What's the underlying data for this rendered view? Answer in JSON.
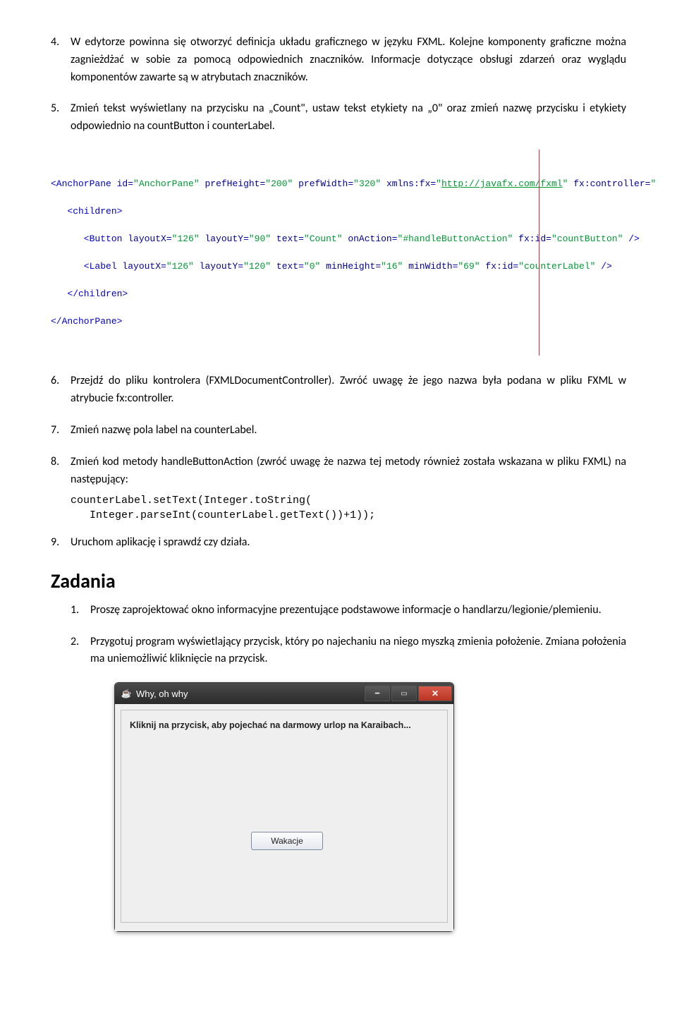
{
  "paragraphs": {
    "p4": "W edytorze powinna się otworzyć definicja układu graficznego w języku FXML. Kolejne komponenty graficzne można zagnieżdżać w sobie za pomocą odpowiednich znaczników. Informacje dotyczące obsługi zdarzeń oraz wyglądu komponentów zawarte są w atrybutach znaczników.",
    "p5": "Zmień tekst wyświetlany na przycisku na „Count\", ustaw tekst etykiety na „0\" oraz zmień nazwę przycisku i etykiety odpowiednio na countButton i counterLabel.",
    "p6": "Przejdź do pliku kontrolera (FXMLDocumentController). Zwróć uwagę że jego nazwa była podana w pliku FXML w atrybucie fx:controller.",
    "p7": "Zmień nazwę pola label na counterLabel.",
    "p8": "Zmień kod metody handleButtonAction (zwróć uwagę że nazwa tej metody również została wskazana w pliku FXML) na następujący:",
    "p9": "Uruchom aplikację i sprawdź czy działa."
  },
  "nums": {
    "n4": "4.",
    "n5": "5.",
    "n6": "6.",
    "n7": "7.",
    "n8": "8.",
    "n9": "9."
  },
  "code_block": {
    "line1": "counterLabel.setText(Integer.toString(",
    "line2": "   Integer.parseInt(counterLabel.getText())+1));"
  },
  "zadania": {
    "heading": "Zadania",
    "n1": "1.",
    "t1": "Proszę zaprojektować okno informacyjne prezentujące podstawowe informacje o handlarzu/legionie/plemieniu.",
    "n2": "2.",
    "t2": "Przygotuj program wyświetlający przycisk, który po najechaniu na niego myszką zmienia położenie. Zmiana położenia ma uniemożliwić kliknięcie na przycisk."
  },
  "fxml": {
    "open_tag": "<AnchorPane",
    "attrs_root": " id=\"AnchorPane\" prefHeight=\"200\" prefWidth=\"320\" xmlns:fx=\"",
    "url": "http://javafx.com/fxml",
    "attrs_root_end": "\" fx:controller=\"",
    "children_open": "   <children>",
    "button_line_a": "      <Button layoutX=\"126\" layoutY=\"90\" text=\"Count\" onAction=\"#handleButtonA",
    "button_line_b": "ction\" fx:id=\"countButton\" />",
    "label_line_a": "      <Label layoutX=\"126\" layoutY=\"120\" text=\"0\" minHeight=\"16\" minWidth=\"69\"",
    "label_line_b": " fx:id=\"counterLabel\" />",
    "children_close": "   </children>",
    "close_tag": "</AnchorPane>"
  },
  "window": {
    "title": "Why, oh why",
    "hint": "Kliknij na przycisk, aby pojechać na darmowy urlop na Karaibach...",
    "button": "Wakacje",
    "java_icon": "☕",
    "min_glyph": "━",
    "max_glyph": "▭",
    "close_glyph": "✕"
  }
}
